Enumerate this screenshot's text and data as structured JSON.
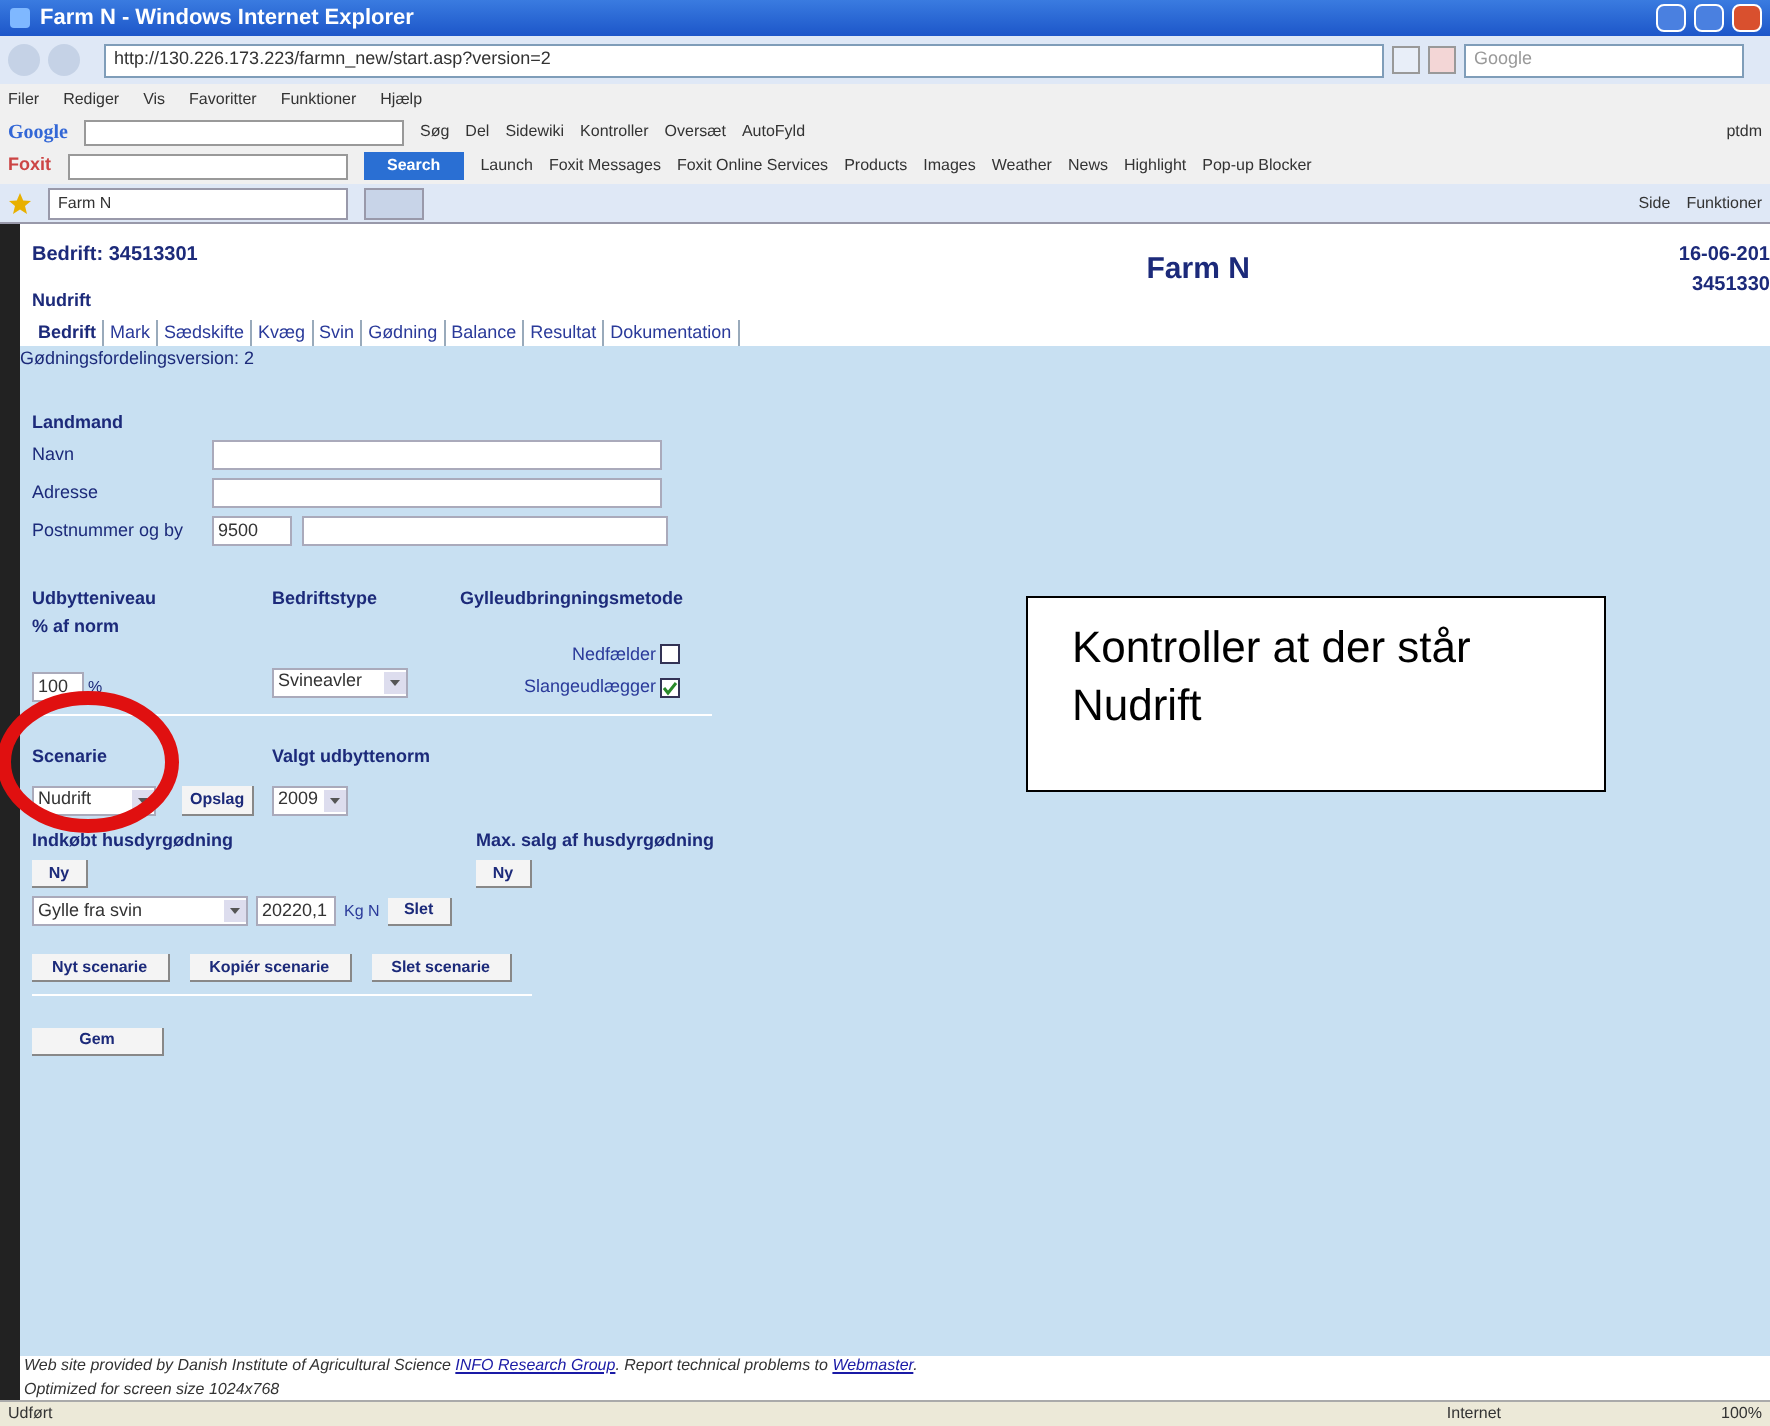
{
  "window": {
    "title": "Farm N - Windows Internet Explorer"
  },
  "address_bar": {
    "url": "http://130.226.173.223/farmn_new/start.asp?version=2",
    "search_placeholder": "Google"
  },
  "menu_bar": [
    "Filer",
    "Rediger",
    "Vis",
    "Favoritter",
    "Funktioner",
    "Hjælp"
  ],
  "google_toolbar": {
    "logo": "Google",
    "items": [
      "Søg",
      "Del",
      "Sidewiki",
      "Kontroller",
      "Oversæt",
      "AutoFyld"
    ],
    "account": "ptdm"
  },
  "foxit_toolbar": {
    "logo": "Foxit",
    "search_button": "Search",
    "items": [
      "Launch",
      "Foxit Messages",
      "Foxit Online Services",
      "Products",
      "Images",
      "Weather",
      "News",
      "Highlight",
      "Pop-up Blocker"
    ]
  },
  "browser_tabs": [
    {
      "label": "Farm N",
      "selected": true
    }
  ],
  "command_bar": [
    "Side",
    "Funktioner"
  ],
  "page": {
    "company": "Bedrift: 34513301",
    "site_title": "Farm N",
    "date": "16-06-201",
    "id": "3451330",
    "scenario_name": "Nudrift",
    "tabs": [
      {
        "label": "Bedrift",
        "selected": true
      },
      {
        "label": "Mark",
        "selected": false
      },
      {
        "label": "Sædskifte",
        "selected": false
      },
      {
        "label": "Kvæg",
        "selected": false
      },
      {
        "label": "Svin",
        "selected": false
      },
      {
        "label": "Gødning",
        "selected": false
      },
      {
        "label": "Balance",
        "selected": false
      },
      {
        "label": "Resultat",
        "selected": false
      },
      {
        "label": "Dokumentation",
        "selected": false
      }
    ],
    "version": "Gødningsfordelingsversion: 2",
    "farmer": {
      "heading": "Landmand",
      "name_label": "Navn",
      "address_label": "Adresse",
      "postal_label": "Postnummer og by",
      "postal_code": "9500"
    },
    "yield": {
      "heading": "Udbytteniveau",
      "subheading": "% af norm",
      "value": "100",
      "unit": "%"
    },
    "farm_type": {
      "heading": "Bedriftstype",
      "value": "Svineavler"
    },
    "slurry": {
      "heading": "Gylleudbringningsmetode",
      "options": [
        {
          "label": "Nedfælder",
          "checked": false
        },
        {
          "label": "Slangeudlægger",
          "checked": true
        }
      ]
    },
    "scenario": {
      "heading": "Scenarie",
      "value": "Nudrift",
      "button": "Opslag"
    },
    "norm": {
      "heading": "Valgt udbyttenorm",
      "value": "2009"
    },
    "purchased": {
      "heading": "Indkøbt husdyrgødning",
      "new_button": "Ny",
      "type": "Gylle fra svin",
      "amount": "20220,1",
      "unit": "Kg N",
      "delete_button": "Slet"
    },
    "max_sale": {
      "heading": "Max. salg af husdyrgødning",
      "new_button": "Ny"
    },
    "scenario_buttons": [
      "Nyt scenarie",
      "Kopiér scenarie",
      "Slet scenarie"
    ],
    "save_button": "Gem",
    "footer": {
      "line1": "Web site provided by Danish Institute of Agricultural Science ",
      "link1": "INFO Research Group",
      "line1b": ". Report technical problems to ",
      "link2": "Webmaster",
      "line1c": ".",
      "line2": "Optimized for screen size 1024x768"
    }
  },
  "annotation": {
    "text": "Kontroller at der står Nudrift"
  },
  "status_bar": {
    "status": "Udført",
    "zone": "Internet",
    "zoom": "100%"
  }
}
